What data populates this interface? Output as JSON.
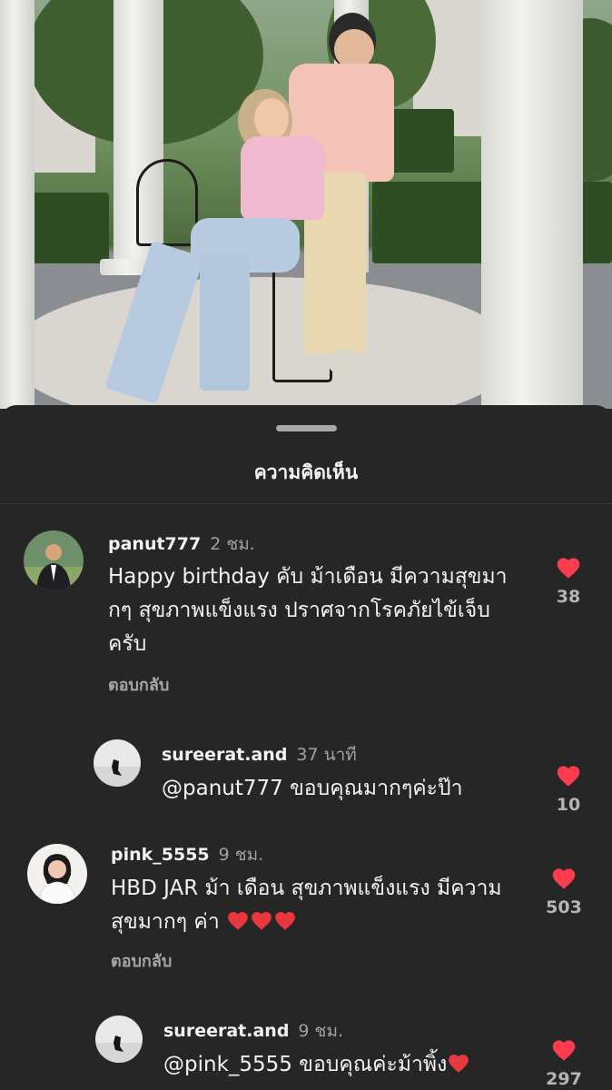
{
  "sheet": {
    "title": "ความคิดเห็น"
  },
  "colors": {
    "like_red": "#ff3b4f",
    "sheet_bg": "#262626",
    "muted": "#a0a0a0"
  },
  "comments": [
    {
      "username": "panut777",
      "time": "2 ชม.",
      "text": "Happy birthday คับ ม้าเดือน มีความสุขมากๆ  สุขภาพแข็งแรง ปราศจากโรคภัยไข้เจ็บครับ",
      "reply_label": "ตอบกลับ",
      "likes": "38",
      "replies": [
        {
          "username": "sureerat.and",
          "time": "37 นาที",
          "text": "@panut777 ขอบคุณมากๆค่ะป๊า",
          "likes": "10"
        }
      ]
    },
    {
      "username": "pink_5555",
      "time": "9 ชม.",
      "text": "HBD JAR ม้า เดือน สุขภาพแข็งแรง มีความสุขมากๆ ค่า",
      "text_emoji": "red-heart x3",
      "reply_label": "ตอบกลับ",
      "likes": "503",
      "replies": [
        {
          "username": "sureerat.and",
          "time": "9 ชม.",
          "text": "@pink_5555 ขอบคุณค่ะม้าพิ้ง",
          "text_emoji": "red-heart",
          "likes": "297"
        }
      ]
    }
  ]
}
